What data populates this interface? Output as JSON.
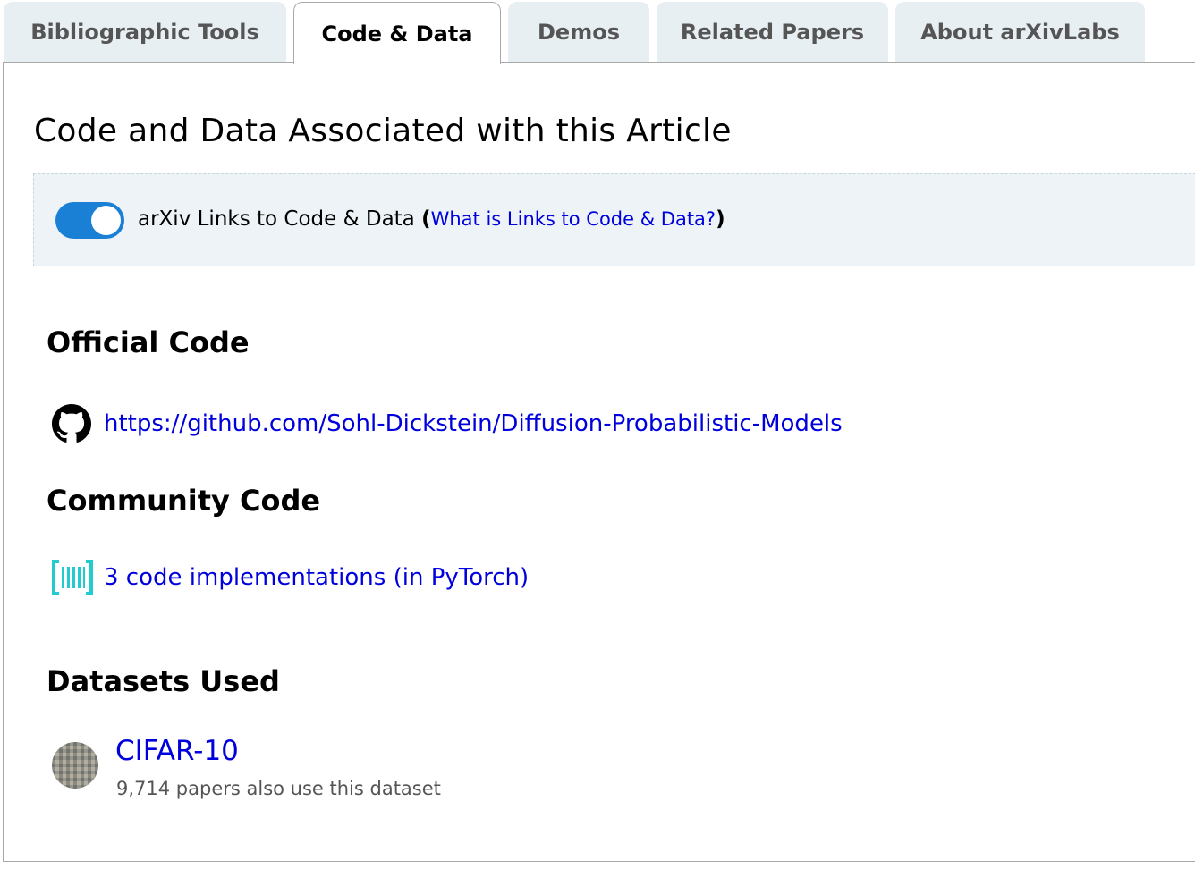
{
  "tabs": [
    {
      "label": "Bibliographic Tools",
      "active": false
    },
    {
      "label": "Code & Data",
      "active": true
    },
    {
      "label": "Demos",
      "active": false
    },
    {
      "label": "Related Papers",
      "active": false
    },
    {
      "label": "About arXivLabs",
      "active": false
    }
  ],
  "page": {
    "title": "Code and Data Associated with this Article"
  },
  "toggle": {
    "on": true,
    "label": "arXiv Links to Code & Data",
    "open_paren": "(",
    "help_link": "What is Links to Code & Data?",
    "close_paren": ")"
  },
  "official_code": {
    "heading": "Official Code",
    "icon": "github-icon",
    "url": "https://github.com/Sohl-Dickstein/Diffusion-Probabilistic-Models"
  },
  "community_code": {
    "heading": "Community Code",
    "icon": "papers-with-code-icon",
    "link": "3 code implementations (in PyTorch)"
  },
  "datasets": {
    "heading": "Datasets Used",
    "items": [
      {
        "name": "CIFAR-10",
        "count": "9,714 papers also use this dataset",
        "icon": "dataset-thumbnail"
      }
    ]
  },
  "colors": {
    "link": "#0000dd",
    "toggle_on": "#1a80d6",
    "tab_bg": "#e8eff2",
    "box_bg": "#edf3f6",
    "pwc_cyan": "#21cbce"
  }
}
